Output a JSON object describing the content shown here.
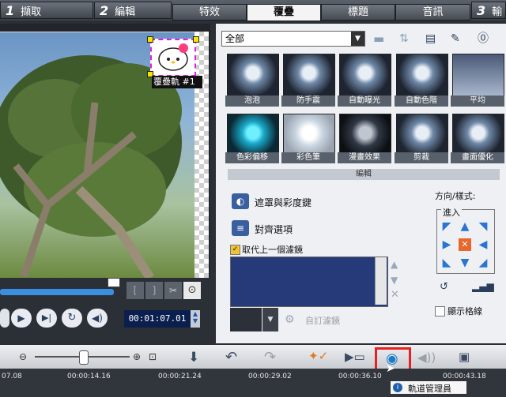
{
  "steps": [
    {
      "num": "1",
      "label": "擷取"
    },
    {
      "num": "2",
      "label": "編輯"
    },
    {
      "num": "3",
      "label": "輸"
    }
  ],
  "modes": [
    "特效",
    "覆疊",
    "標題",
    "音訊"
  ],
  "active_mode": "覆疊",
  "preview": {
    "overlay_label": "覆疊軌 #1",
    "timecode": "00:01:07.01"
  },
  "filter": {
    "dropdown": "全部"
  },
  "effects": [
    "泡泡",
    "防手震",
    "自動曝光",
    "自動色階",
    "平均",
    "色彩偏移",
    "彩色筆",
    "漫畫效果",
    "剪裁",
    "畫面優化"
  ],
  "edit": {
    "title": "編輯",
    "mask_label": "遮罩與彩度鍵",
    "align_label": "對齊選項",
    "replace_label": "取代上一個濾鏡",
    "custom_filter": "自訂濾鏡",
    "direction_label": "方向/樣式:",
    "enter_label": "進入",
    "grid_label": "顯示格線"
  },
  "timeline": {
    "ticks": [
      "07.08",
      "00:00:14.16",
      "00:00:21.24",
      "00:00:29.02",
      "00:00:36.10",
      "00:00:43.18"
    ],
    "tooltip": "軌道管理員"
  },
  "colors": {
    "accent": "#e82020",
    "tab_active": "#f4f4f4"
  }
}
